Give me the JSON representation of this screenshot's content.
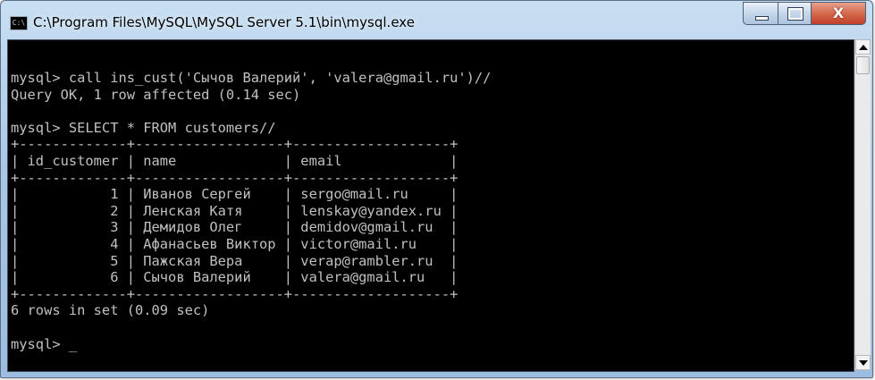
{
  "window": {
    "title": "C:\\Program Files\\MySQL\\MySQL Server 5.1\\bin\\mysql.exe",
    "icon_label": "C:\\",
    "controls": {
      "minimize": "minimize-icon",
      "maximize": "maximize-icon",
      "close": "close-icon",
      "close_glyph": "X"
    },
    "accent_close": "#c2402a"
  },
  "console": {
    "background": "#000000",
    "foreground": "#c0c0c0",
    "lines": [
      "mysql> call ins_cust('Сычов Валерий', 'valera@gmail.ru')//",
      "Query OK, 1 row affected (0.14 sec)",
      "",
      "mysql> SELECT * FROM customers//",
      "+-------------+------------------+-------------------+",
      "| id_customer | name             | email             |",
      "+-------------+------------------+-------------------+",
      "|           1 | Иванов Сергей    | sergo@mail.ru     |",
      "|           2 | Ленская Катя     | lenskay@yandex.ru |",
      "|           3 | Демидов Олег     | demidov@gmail.ru  |",
      "|           4 | Афанасьев Виктор | victor@mail.ru    |",
      "|           5 | Пажская Вера     | verap@rambler.ru  |",
      "|           6 | Сычов Валерий    | valera@gmail.ru   |",
      "+-------------+------------------+-------------------+",
      "6 rows in set (0.09 sec)",
      "",
      "mysql> "
    ],
    "cursor": "_"
  },
  "scrollbar": {
    "up": "scroll-up-arrow-icon",
    "down": "scroll-down-arrow-icon"
  }
}
